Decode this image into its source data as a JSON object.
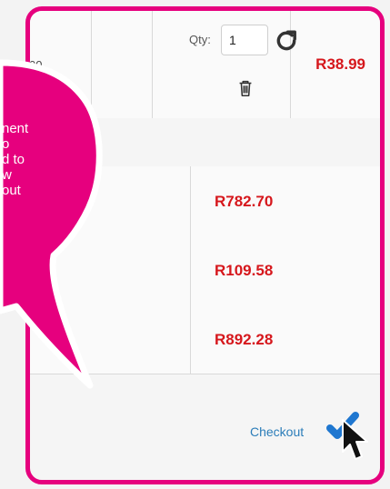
{
  "cart": {
    "item": {
      "partial_value": "00",
      "qty_label": "Qty:",
      "qty_value": "1",
      "price": "R38.99"
    },
    "totals": [
      "R782.70",
      "R109.58",
      "R892.28"
    ],
    "checkout_label": "Checkout"
  },
  "callout": {
    "text_lines": "nent\no\nd to\nw\nout"
  },
  "colors": {
    "accent_border": "#e6007e",
    "price_red": "#d6171c",
    "link_blue": "#2b7db9",
    "check_blue": "#1f77d0"
  },
  "icons": {
    "refresh": "refresh-icon",
    "delete": "trash-icon",
    "confirm": "checkmark-icon",
    "pointer": "mouse-cursor-icon"
  }
}
